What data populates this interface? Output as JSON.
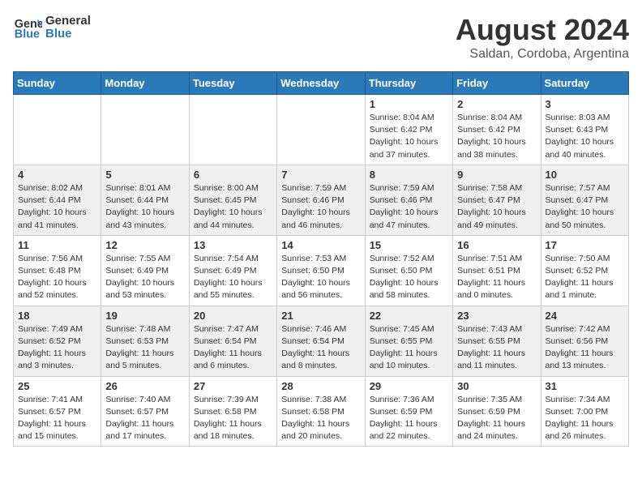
{
  "header": {
    "logo_line1": "General",
    "logo_line2": "Blue",
    "month": "August 2024",
    "location": "Saldan, Cordoba, Argentina"
  },
  "weekdays": [
    "Sunday",
    "Monday",
    "Tuesday",
    "Wednesday",
    "Thursday",
    "Friday",
    "Saturday"
  ],
  "weeks": [
    [
      {
        "day": "",
        "info": ""
      },
      {
        "day": "",
        "info": ""
      },
      {
        "day": "",
        "info": ""
      },
      {
        "day": "",
        "info": ""
      },
      {
        "day": "1",
        "info": "Sunrise: 8:04 AM\nSunset: 6:42 PM\nDaylight: 10 hours\nand 37 minutes."
      },
      {
        "day": "2",
        "info": "Sunrise: 8:04 AM\nSunset: 6:42 PM\nDaylight: 10 hours\nand 38 minutes."
      },
      {
        "day": "3",
        "info": "Sunrise: 8:03 AM\nSunset: 6:43 PM\nDaylight: 10 hours\nand 40 minutes."
      }
    ],
    [
      {
        "day": "4",
        "info": "Sunrise: 8:02 AM\nSunset: 6:44 PM\nDaylight: 10 hours\nand 41 minutes."
      },
      {
        "day": "5",
        "info": "Sunrise: 8:01 AM\nSunset: 6:44 PM\nDaylight: 10 hours\nand 43 minutes."
      },
      {
        "day": "6",
        "info": "Sunrise: 8:00 AM\nSunset: 6:45 PM\nDaylight: 10 hours\nand 44 minutes."
      },
      {
        "day": "7",
        "info": "Sunrise: 7:59 AM\nSunset: 6:46 PM\nDaylight: 10 hours\nand 46 minutes."
      },
      {
        "day": "8",
        "info": "Sunrise: 7:59 AM\nSunset: 6:46 PM\nDaylight: 10 hours\nand 47 minutes."
      },
      {
        "day": "9",
        "info": "Sunrise: 7:58 AM\nSunset: 6:47 PM\nDaylight: 10 hours\nand 49 minutes."
      },
      {
        "day": "10",
        "info": "Sunrise: 7:57 AM\nSunset: 6:47 PM\nDaylight: 10 hours\nand 50 minutes."
      }
    ],
    [
      {
        "day": "11",
        "info": "Sunrise: 7:56 AM\nSunset: 6:48 PM\nDaylight: 10 hours\nand 52 minutes."
      },
      {
        "day": "12",
        "info": "Sunrise: 7:55 AM\nSunset: 6:49 PM\nDaylight: 10 hours\nand 53 minutes."
      },
      {
        "day": "13",
        "info": "Sunrise: 7:54 AM\nSunset: 6:49 PM\nDaylight: 10 hours\nand 55 minutes."
      },
      {
        "day": "14",
        "info": "Sunrise: 7:53 AM\nSunset: 6:50 PM\nDaylight: 10 hours\nand 56 minutes."
      },
      {
        "day": "15",
        "info": "Sunrise: 7:52 AM\nSunset: 6:50 PM\nDaylight: 10 hours\nand 58 minutes."
      },
      {
        "day": "16",
        "info": "Sunrise: 7:51 AM\nSunset: 6:51 PM\nDaylight: 11 hours\nand 0 minutes."
      },
      {
        "day": "17",
        "info": "Sunrise: 7:50 AM\nSunset: 6:52 PM\nDaylight: 11 hours\nand 1 minute."
      }
    ],
    [
      {
        "day": "18",
        "info": "Sunrise: 7:49 AM\nSunset: 6:52 PM\nDaylight: 11 hours\nand 3 minutes."
      },
      {
        "day": "19",
        "info": "Sunrise: 7:48 AM\nSunset: 6:53 PM\nDaylight: 11 hours\nand 5 minutes."
      },
      {
        "day": "20",
        "info": "Sunrise: 7:47 AM\nSunset: 6:54 PM\nDaylight: 11 hours\nand 6 minutes."
      },
      {
        "day": "21",
        "info": "Sunrise: 7:46 AM\nSunset: 6:54 PM\nDaylight: 11 hours\nand 8 minutes."
      },
      {
        "day": "22",
        "info": "Sunrise: 7:45 AM\nSunset: 6:55 PM\nDaylight: 11 hours\nand 10 minutes."
      },
      {
        "day": "23",
        "info": "Sunrise: 7:43 AM\nSunset: 6:55 PM\nDaylight: 11 hours\nand 11 minutes."
      },
      {
        "day": "24",
        "info": "Sunrise: 7:42 AM\nSunset: 6:56 PM\nDaylight: 11 hours\nand 13 minutes."
      }
    ],
    [
      {
        "day": "25",
        "info": "Sunrise: 7:41 AM\nSunset: 6:57 PM\nDaylight: 11 hours\nand 15 minutes."
      },
      {
        "day": "26",
        "info": "Sunrise: 7:40 AM\nSunset: 6:57 PM\nDaylight: 11 hours\nand 17 minutes."
      },
      {
        "day": "27",
        "info": "Sunrise: 7:39 AM\nSunset: 6:58 PM\nDaylight: 11 hours\nand 18 minutes."
      },
      {
        "day": "28",
        "info": "Sunrise: 7:38 AM\nSunset: 6:58 PM\nDaylight: 11 hours\nand 20 minutes."
      },
      {
        "day": "29",
        "info": "Sunrise: 7:36 AM\nSunset: 6:59 PM\nDaylight: 11 hours\nand 22 minutes."
      },
      {
        "day": "30",
        "info": "Sunrise: 7:35 AM\nSunset: 6:59 PM\nDaylight: 11 hours\nand 24 minutes."
      },
      {
        "day": "31",
        "info": "Sunrise: 7:34 AM\nSunset: 7:00 PM\nDaylight: 11 hours\nand 26 minutes."
      }
    ]
  ]
}
